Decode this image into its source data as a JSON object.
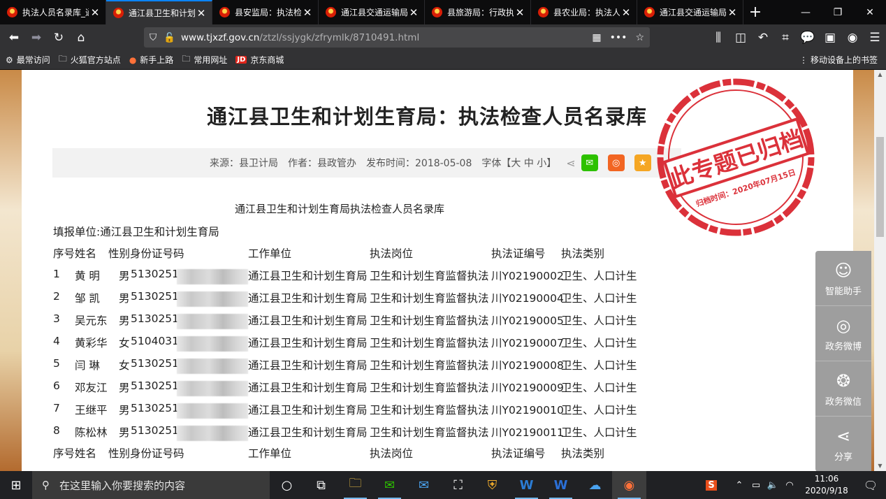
{
  "browser": {
    "tabs": [
      {
        "title": "执法人员名录库_通江县人民政府",
        "active": false
      },
      {
        "title": "通江县卫生和计划生育局",
        "active": true
      },
      {
        "title": "县安监局：执法检查人员",
        "active": false
      },
      {
        "title": "通江县交通运输局",
        "active": false
      },
      {
        "title": "县旅游局：行政执法人员",
        "active": false
      },
      {
        "title": "县农业局：执法人员名录",
        "active": false
      },
      {
        "title": "通江县交通运输局",
        "active": false
      }
    ],
    "url_host": "www.tjxzf.gov.cn",
    "url_path": "/ztzl/ssjygk/zfrymlk/8710491.html",
    "bookmarks": [
      "最常访问",
      "火狐官方站点",
      "新手上路",
      "常用网址",
      "京东商城"
    ],
    "mobile_bookmarks": "移动设备上的书签"
  },
  "article": {
    "title": "通江县卫生和计划生育局：执法检查人员名录库",
    "meta": {
      "source": "来源：县卫计局",
      "author": "作者：县政管办",
      "date": "发布时间：2018-05-08",
      "font": "字体【大 中 小】"
    },
    "doc_heading": "通江县卫生和计划生育局执法检查人员名录库",
    "fill_unit": "填报单位:通江县卫生和计划生育局",
    "headers": {
      "no_name": "序号姓名",
      "sex_id": "性别身份证号码",
      "unit": "工作单位",
      "post": "执法岗位",
      "cert": "执法证编号",
      "type": "执法类别"
    },
    "rows": [
      {
        "no": "1",
        "name": "黄 明",
        "sex": "男",
        "id": "5130251",
        "unit": "通江县卫生和计划生育局",
        "post": "卫生和计划生育监督执法",
        "cert": "川Y02190002",
        "type": "卫生、人口计生"
      },
      {
        "no": "2",
        "name": "邹 凯",
        "sex": "男",
        "id": "5130251",
        "unit": "通江县卫生和计划生育局",
        "post": "卫生和计划生育监督执法",
        "cert": "川Y02190004",
        "type": "卫生、人口计生"
      },
      {
        "no": "3",
        "name": "吴元东",
        "sex": "男",
        "id": "5130251",
        "unit": "通江县卫生和计划生育局",
        "post": "卫生和计划生育监督执法",
        "cert": "川Y02190005",
        "type": "卫生、人口计生"
      },
      {
        "no": "4",
        "name": "黄彩华",
        "sex": "女",
        "id": "5104031",
        "unit": "通江县卫生和计划生育局",
        "post": "卫生和计划生育监督执法",
        "cert": "川Y02190007",
        "type": "卫生、人口计生"
      },
      {
        "no": "5",
        "name": "闫 琳",
        "sex": "女",
        "id": "5130251",
        "unit": "通江县卫生和计划生育局",
        "post": "卫生和计划生育监督执法",
        "cert": "川Y02190008",
        "type": "卫生、人口计生"
      },
      {
        "no": "6",
        "name": "邓友江",
        "sex": "男",
        "id": "5130251",
        "unit": "通江县卫生和计划生育局",
        "post": "卫生和计划生育监督执法",
        "cert": "川Y02190009",
        "type": "卫生、人口计生"
      },
      {
        "no": "7",
        "name": "王继平",
        "sex": "男",
        "id": "5130251",
        "unit": "通江县卫生和计划生育局",
        "post": "卫生和计划生育监督执法",
        "cert": "川Y02190010",
        "type": "卫生、人口计生"
      },
      {
        "no": "8",
        "name": "陈松林",
        "sex": "男",
        "id": "5130251",
        "unit": "通江县卫生和计划生育局",
        "post": "卫生和计划生育监督执法",
        "cert": "川Y02190011",
        "type": "卫生、人口计生"
      }
    ]
  },
  "stamp": {
    "main_text": "此专题已归档",
    "sub_text": "归档时间：2020年07月15日",
    "color": "#d8202a"
  },
  "side_panel": [
    "智能助手",
    "政务微博",
    "政务微信",
    "分享"
  ],
  "taskbar": {
    "search_placeholder": "在这里输入你要搜索的内容",
    "time": "11:06",
    "date": "2020/9/18"
  }
}
